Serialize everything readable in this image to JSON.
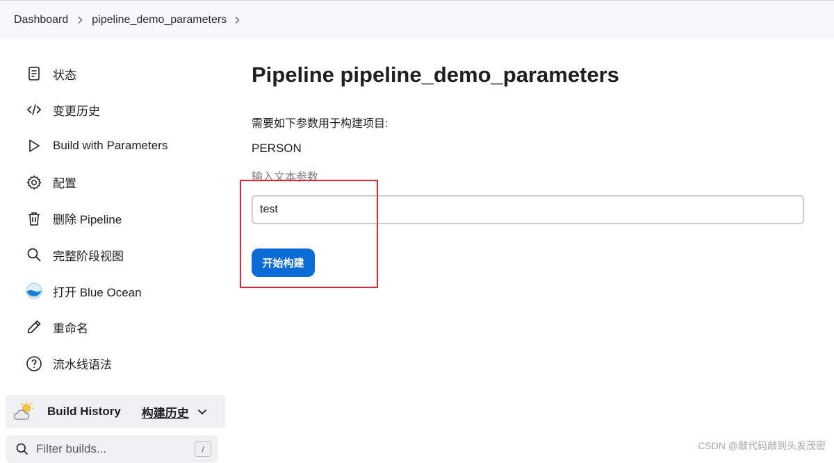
{
  "breadcrumb": {
    "items": [
      "Dashboard",
      "pipeline_demo_parameters"
    ]
  },
  "sidebar": {
    "items": [
      {
        "label": "状态",
        "icon": "document-icon"
      },
      {
        "label": "变更历史",
        "icon": "code-icon"
      },
      {
        "label": "Build with Parameters",
        "icon": "play-icon"
      },
      {
        "label": "配置",
        "icon": "gear-icon"
      },
      {
        "label": "删除 Pipeline",
        "icon": "trash-icon"
      },
      {
        "label": "完整阶段视图",
        "icon": "search-icon"
      },
      {
        "label": "打开 Blue Ocean",
        "icon": "blue-ocean-icon"
      },
      {
        "label": "重命名",
        "icon": "pencil-icon"
      },
      {
        "label": "流水线语法",
        "icon": "help-icon"
      }
    ],
    "build_history": {
      "title": "Build History",
      "link": "构建历史",
      "icon": "weather-cloud-sun-icon"
    },
    "filter": {
      "placeholder": "Filter builds...",
      "shortcut": "/"
    }
  },
  "main": {
    "title": "Pipeline pipeline_demo_parameters",
    "description": "需要如下参数用于构建项目:",
    "parameter": {
      "name": "PERSON",
      "description": "输入文本参数",
      "value": "test"
    },
    "build_button": "开始构建"
  },
  "annotation": {
    "highlight_color": "#e0262b"
  },
  "watermark": "CSDN @敲代码敲到头发茂密",
  "colors": {
    "primary": "#0b6cd6",
    "topbar_bg": "#f8f8fa"
  }
}
